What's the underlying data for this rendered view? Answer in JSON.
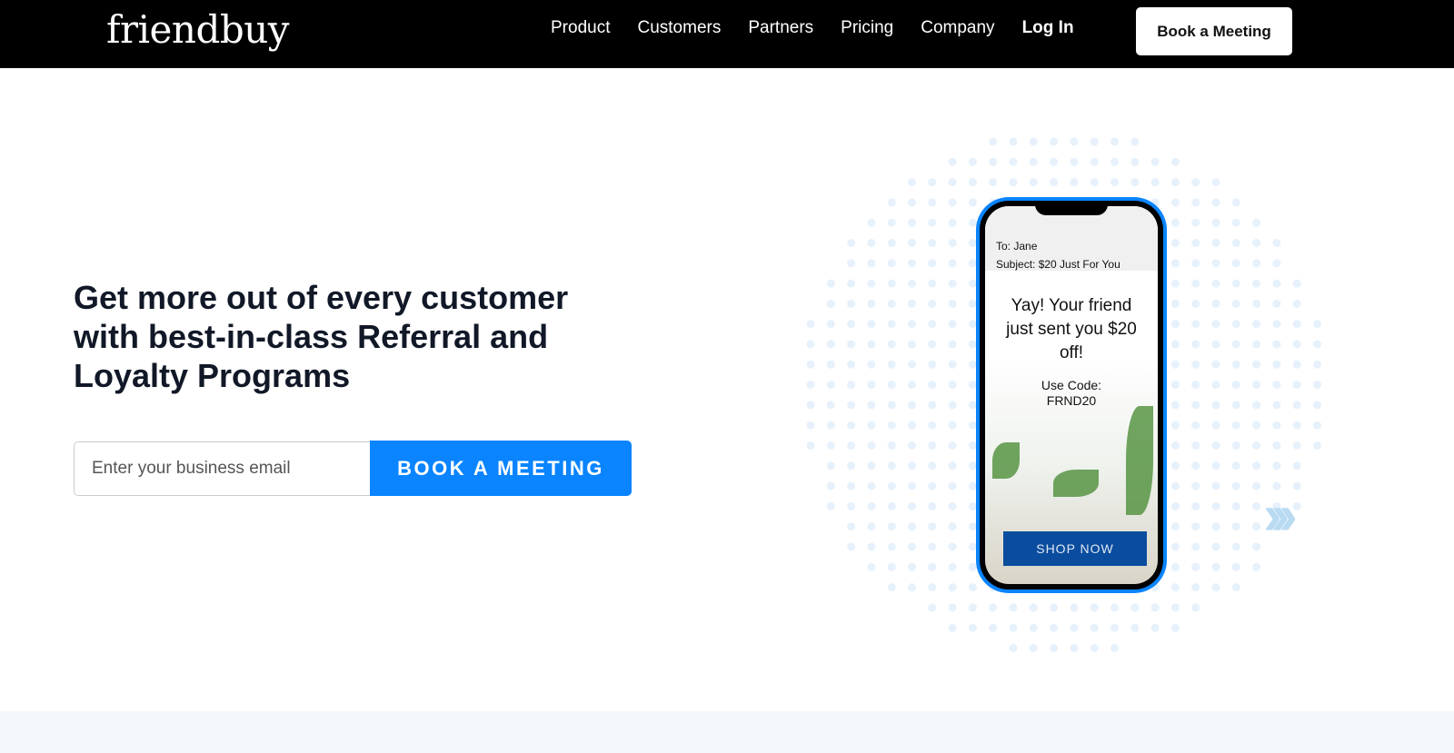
{
  "nav": {
    "logo": "friendbuy",
    "links": [
      "Product",
      "Customers",
      "Partners",
      "Pricing",
      "Company"
    ],
    "login": "Log In",
    "cta": "Book a Meeting"
  },
  "hero": {
    "headline": "Get more out of every customer with best-in-class Referral and Loyalty Programs",
    "email_placeholder": "Enter your business email",
    "cta": "BOOK A MEETING"
  },
  "phone": {
    "to": "To: Jane",
    "subject": "Subject: $20 Just For You",
    "message": "Yay! Your friend just sent you $20 off!",
    "code_label": "Use Code:",
    "code": "FRND20",
    "button": "SHOP NOW"
  },
  "colors": {
    "accent": "#0a84ff",
    "nav_bg": "#000000",
    "dots": "#e6f1fb"
  }
}
